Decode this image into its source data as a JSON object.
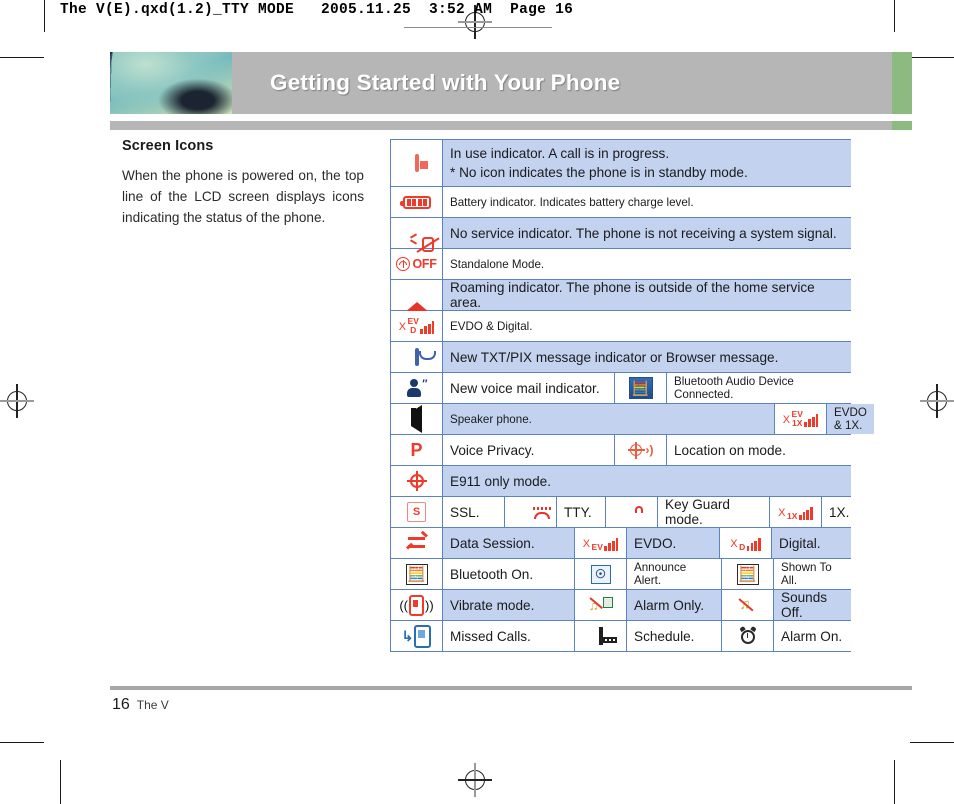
{
  "header": {
    "prepress_line": "The V(E).qxd(1.2)_TTY MODE   2005.11.25  3:52 AM  Page 16"
  },
  "banner": {
    "title": "Getting Started with Your Phone",
    "accent_color": "#8cba80",
    "bar_color": "#b6b6b6"
  },
  "left_column": {
    "section_title": "Screen Icons",
    "body": "When the phone is powered on, the top line of the LCD screen displays icons indicating the status of the phone."
  },
  "table": {
    "border_color": "#5b83c4",
    "row_highlight_color": "#c2d2ef",
    "rows": [
      {
        "style": "blue",
        "cells": [
          {
            "kind": "icon",
            "icon": "phone-in-use-icon"
          },
          {
            "kind": "text_two_line",
            "line1": "In use indicator. A call is in progress.",
            "line2": "* No icon indicates the phone is in standby mode."
          }
        ]
      },
      {
        "style": "white",
        "cells": [
          {
            "kind": "icon",
            "icon": "battery-icon"
          },
          {
            "kind": "text_small",
            "text": "Battery indicator. Indicates battery charge level."
          }
        ]
      },
      {
        "style": "blue",
        "cells": [
          {
            "kind": "icon",
            "icon": "no-service-icon"
          },
          {
            "kind": "text",
            "text": "No service indicator. The phone is not receiving a system signal."
          }
        ]
      },
      {
        "style": "white",
        "cells": [
          {
            "kind": "icon",
            "icon": "standalone-off-icon"
          },
          {
            "kind": "text_small",
            "text": "Standalone Mode."
          }
        ]
      },
      {
        "style": "blue",
        "cells": [
          {
            "kind": "icon",
            "icon": "roaming-triangle-icon"
          },
          {
            "kind": "text",
            "text": "Roaming indicator. The phone is outside of the home service area."
          }
        ]
      },
      {
        "style": "white",
        "cells": [
          {
            "kind": "icon",
            "icon": "signal-evdo-digital-icon"
          },
          {
            "kind": "text_small",
            "text": "EVDO & Digital."
          }
        ]
      },
      {
        "style": "blue",
        "cells": [
          {
            "kind": "icon",
            "icon": "envelope-message-icon"
          },
          {
            "kind": "text",
            "text": "New TXT/PIX message indicator or Browser message."
          }
        ]
      },
      {
        "style": "white",
        "cells": [
          {
            "kind": "icon",
            "icon": "voice-mail-icon"
          },
          {
            "kind": "text",
            "text": "New voice mail indicator."
          },
          {
            "kind": "icon",
            "icon": "bluetooth-audio-connected-icon"
          },
          {
            "kind": "text_small",
            "text": "Bluetooth Audio Device Connected."
          }
        ]
      },
      {
        "style": "blue",
        "cells": [
          {
            "kind": "icon",
            "icon": "speaker-phone-icon"
          },
          {
            "kind": "text_small",
            "text": "Speaker phone."
          },
          {
            "kind": "icon",
            "icon": "signal-evdo-1x-icon"
          },
          {
            "kind": "text_small",
            "text": "EVDO & 1X."
          }
        ]
      },
      {
        "style": "white",
        "cells": [
          {
            "kind": "icon",
            "icon": "voice-privacy-p-icon"
          },
          {
            "kind": "text",
            "text": "Voice Privacy."
          },
          {
            "kind": "icon",
            "icon": "location-on-icon"
          },
          {
            "kind": "text",
            "text": "Location on mode."
          }
        ]
      },
      {
        "style": "blue",
        "cells": [
          {
            "kind": "icon",
            "icon": "e911-crosshair-icon"
          },
          {
            "kind": "text",
            "text": "E911 only mode."
          }
        ]
      },
      {
        "style": "white",
        "cells": [
          {
            "kind": "icon",
            "icon": "ssl-icon"
          },
          {
            "kind": "text",
            "text": "SSL."
          },
          {
            "kind": "icon",
            "icon": "tty-icon"
          },
          {
            "kind": "text",
            "text": "TTY."
          },
          {
            "kind": "icon",
            "icon": "key-guard-lock-icon"
          },
          {
            "kind": "text",
            "text": "Key Guard mode."
          },
          {
            "kind": "icon",
            "icon": "signal-1x-icon"
          },
          {
            "kind": "text",
            "text": "1X."
          }
        ]
      },
      {
        "style": "blue",
        "cells": [
          {
            "kind": "icon",
            "icon": "data-session-arrows-icon"
          },
          {
            "kind": "text",
            "text": "Data Session."
          },
          {
            "kind": "icon",
            "icon": "signal-ev-icon"
          },
          {
            "kind": "text",
            "text": "EVDO."
          },
          {
            "kind": "icon",
            "icon": "signal-d-icon"
          },
          {
            "kind": "text",
            "text": "Digital."
          }
        ]
      },
      {
        "style": "white",
        "cells": [
          {
            "kind": "icon",
            "icon": "bluetooth-on-icon"
          },
          {
            "kind": "text",
            "text": "Bluetooth On."
          },
          {
            "kind": "icon",
            "icon": "announce-alert-icon"
          },
          {
            "kind": "text_small",
            "text": "Announce Alert."
          },
          {
            "kind": "icon",
            "icon": "bluetooth-shown-to-all-icon"
          },
          {
            "kind": "text_small",
            "text": "Shown To All."
          }
        ]
      },
      {
        "style": "blue",
        "cells": [
          {
            "kind": "icon",
            "icon": "vibrate-mode-icon"
          },
          {
            "kind": "text",
            "text": "Vibrate mode."
          },
          {
            "kind": "icon",
            "icon": "alarm-only-icon"
          },
          {
            "kind": "text",
            "text": "Alarm Only."
          },
          {
            "kind": "icon",
            "icon": "sounds-off-icon"
          },
          {
            "kind": "text",
            "text": "Sounds Off."
          }
        ]
      },
      {
        "style": "white",
        "cells": [
          {
            "kind": "icon",
            "icon": "missed-calls-icon"
          },
          {
            "kind": "text",
            "text": "Missed Calls."
          },
          {
            "kind": "icon",
            "icon": "schedule-calendar-icon"
          },
          {
            "kind": "text",
            "text": "Schedule."
          },
          {
            "kind": "icon",
            "icon": "alarm-on-icon"
          },
          {
            "kind": "text",
            "text": "Alarm On."
          }
        ]
      }
    ]
  },
  "footer": {
    "page_number": "16",
    "book_title": "The V"
  }
}
